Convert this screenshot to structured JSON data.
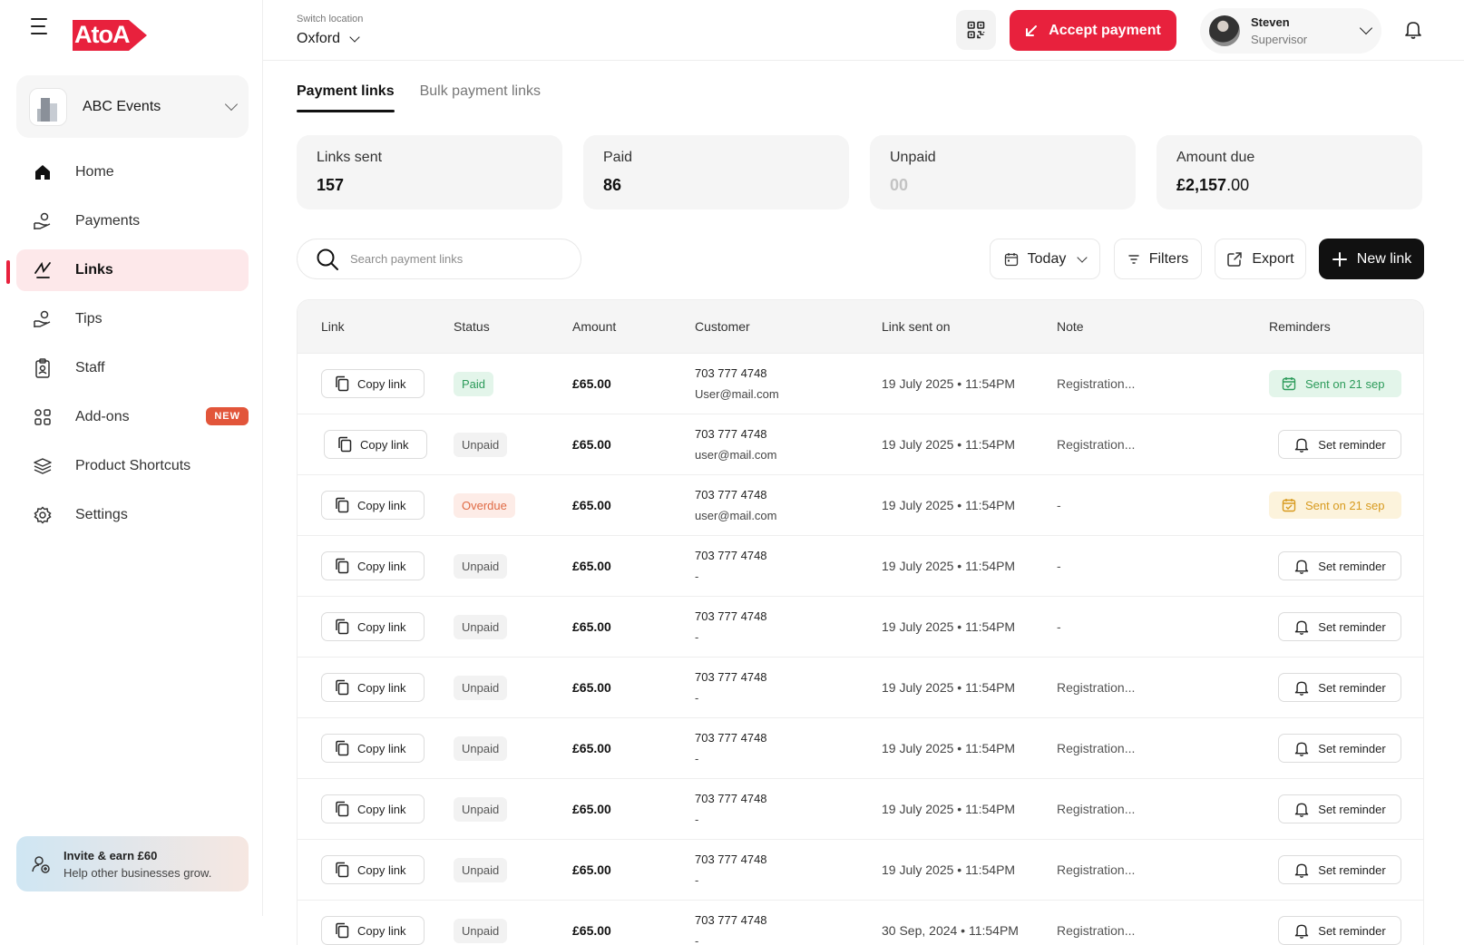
{
  "brand": {
    "logo_text": "AtoA",
    "accent": "#e8213d"
  },
  "sidebar": {
    "business_name": "ABC Events",
    "items": [
      {
        "label": "Home",
        "icon": "home-icon"
      },
      {
        "label": "Payments",
        "icon": "payments-icon"
      },
      {
        "label": "Links",
        "icon": "links-icon",
        "active": true
      },
      {
        "label": "Tips",
        "icon": "tips-icon"
      },
      {
        "label": "Staff",
        "icon": "staff-icon"
      },
      {
        "label": "Add-ons",
        "icon": "addons-icon",
        "badge": "NEW"
      },
      {
        "label": "Product Shortcuts",
        "icon": "stack-icon"
      },
      {
        "label": "Settings",
        "icon": "gear-icon"
      }
    ],
    "invite": {
      "title": "Invite & earn £60",
      "subtitle": "Help other businesses grow."
    }
  },
  "header": {
    "location_label": "Switch location",
    "location_value": "Oxford",
    "accept_payment": "Accept payment",
    "user": {
      "name": "Steven",
      "role": "Supervisor"
    }
  },
  "tabs": [
    {
      "label": "Payment links",
      "active": true
    },
    {
      "label": "Bulk payment links",
      "active": false
    }
  ],
  "stats": [
    {
      "label": "Links sent",
      "value": "157"
    },
    {
      "label": "Paid",
      "value": "86"
    },
    {
      "label": "Unpaid",
      "value": "00"
    },
    {
      "label": "Amount due",
      "value_main": "£2,157",
      "value_dec": ".00"
    }
  ],
  "toolbar": {
    "search_placeholder": "Search payment links",
    "date_filter": "Today",
    "filters": "Filters",
    "export": "Export",
    "new_link": "New link"
  },
  "table": {
    "columns": [
      "Link",
      "Status",
      "Amount",
      "Customer",
      "Link sent on",
      "Note",
      "Reminders"
    ],
    "copy_label": "Copy link",
    "set_reminder_label": "Set reminder",
    "rows": [
      {
        "status": "Paid",
        "amount": "£65.00",
        "phone": "703 777 4748",
        "email": "User@mail.com",
        "sent_on": "19 July 2025 • 11:54PM",
        "note": "Registration...",
        "reminder": "Sent on 21 sep",
        "reminder_state": "sent-green"
      },
      {
        "status": "Unpaid",
        "amount": "£65.00",
        "phone": "703 777 4748",
        "email": "user@mail.com",
        "sent_on": "19 July 2025 • 11:54PM",
        "note": "Registration...",
        "reminder": "Set reminder",
        "reminder_state": "set"
      },
      {
        "status": "Overdue",
        "amount": "£65.00",
        "phone": "703 777 4748",
        "email": "user@mail.com",
        "sent_on": "19 July 2025 • 11:54PM",
        "note": "-",
        "reminder": "Sent on 21 sep",
        "reminder_state": "sent-yellow"
      },
      {
        "status": "Unpaid",
        "amount": "£65.00",
        "phone": "703 777 4748",
        "email": "-",
        "sent_on": "19 July 2025 • 11:54PM",
        "note": "-",
        "reminder": "Set reminder",
        "reminder_state": "set"
      },
      {
        "status": "Unpaid",
        "amount": "£65.00",
        "phone": "703 777 4748",
        "email": "-",
        "sent_on": "19 July 2025 • 11:54PM",
        "note": "-",
        "reminder": "Set reminder",
        "reminder_state": "set"
      },
      {
        "status": "Unpaid",
        "amount": "£65.00",
        "phone": "703 777 4748",
        "email": "-",
        "sent_on": "19 July 2025 • 11:54PM",
        "note": "Registration...",
        "reminder": "Set reminder",
        "reminder_state": "set"
      },
      {
        "status": "Unpaid",
        "amount": "£65.00",
        "phone": "703 777 4748",
        "email": "-",
        "sent_on": "19 July 2025 • 11:54PM",
        "note": "Registration...",
        "reminder": "Set reminder",
        "reminder_state": "set"
      },
      {
        "status": "Unpaid",
        "amount": "£65.00",
        "phone": "703 777 4748",
        "email": "-",
        "sent_on": "19 July 2025 • 11:54PM",
        "note": "Registration...",
        "reminder": "Set reminder",
        "reminder_state": "set"
      },
      {
        "status": "Unpaid",
        "amount": "£65.00",
        "phone": "703 777 4748",
        "email": "-",
        "sent_on": "19 July 2025 • 11:54PM",
        "note": "Registration...",
        "reminder": "Set reminder",
        "reminder_state": "set"
      },
      {
        "status": "Unpaid",
        "amount": "£65.00",
        "phone": "703 777 4748",
        "email": "-",
        "sent_on": "30 Sep, 2024 • 11:54PM",
        "note": "Registration...",
        "reminder": "Set reminder",
        "reminder_state": "set"
      }
    ]
  }
}
